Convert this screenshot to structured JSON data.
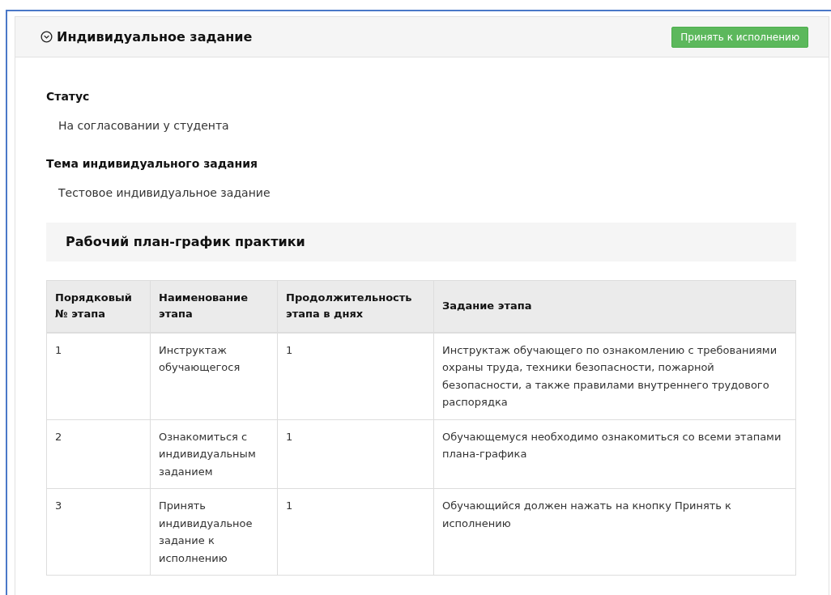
{
  "panel": {
    "title": "Индивидуальное задание",
    "expanded": true,
    "accept_button": "Принять к исполнению"
  },
  "fields": [
    {
      "label": "Статус",
      "value": "На согласовании у студента"
    },
    {
      "label": "Тема индивидуального задания",
      "value": "Тестовое индивидуальное задание"
    }
  ],
  "plan": {
    "title": "Рабочий план-график практики",
    "table": {
      "columns": [
        "Порядковый № этапа",
        "Наименование этапа",
        "Продолжительность этапа в днях",
        "Задание этапа"
      ],
      "rows": [
        [
          "1",
          "Инструктаж обучающегося",
          "1",
          "Инструктаж обучающего по ознакомлению с требованиями охраны труда, техники безопасности, пожарной безопасности, а также правилами внутреннего трудового распорядка"
        ],
        [
          "2",
          "Ознакомиться с индивидуальным заданием",
          "1",
          "Обучающемуся необходимо ознакомиться со всеми этапами плана-графика"
        ],
        [
          "3",
          "Принять индивидуальное задание к исполнению",
          "1",
          "Обучающийся должен нажать на кнопку Принять к исполнению"
        ]
      ]
    }
  }
}
